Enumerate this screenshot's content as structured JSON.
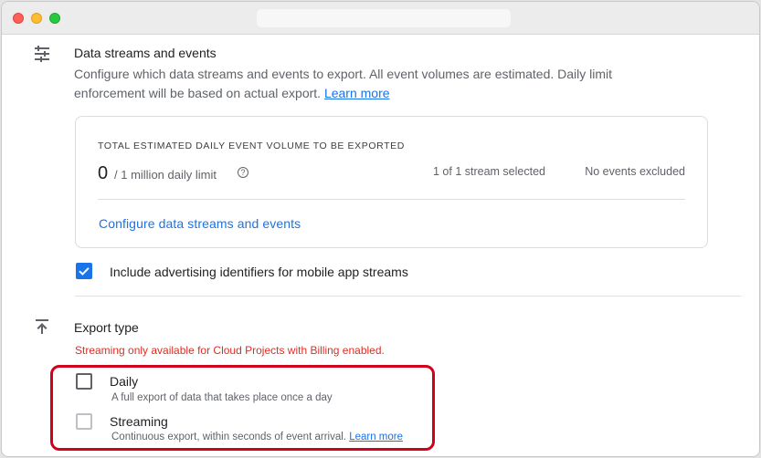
{
  "colors": {
    "accent": "#1a73e8",
    "warning": "#d93025",
    "highlight_border": "#d0021b",
    "text_primary": "#202124",
    "text_secondary": "#5f6368"
  },
  "data_streams": {
    "icon": "tune-icon",
    "title": "Data streams and events",
    "description": "Configure which data streams and events to export. All event volumes are estimated. Daily limit enforcement will be based on actual export.",
    "learn_more": "Learn more",
    "card": {
      "label": "TOTAL ESTIMATED DAILY EVENT VOLUME TO BE EXPORTED",
      "volume": "0",
      "limit": "/ 1 million daily limit",
      "help_icon": "help-icon",
      "help_glyph": "?",
      "streams_selected": "1 of 1 stream selected",
      "events_excluded": "No events excluded",
      "configure_link": "Configure data streams and events"
    },
    "advertising_ids": {
      "label": "Include advertising identifiers for mobile app streams",
      "checked": true
    }
  },
  "export_type": {
    "icon": "upload-icon",
    "title": "Export type",
    "warning": "Streaming only available for Cloud Projects with Billing enabled.",
    "options": [
      {
        "title": "Daily",
        "description": "A full export of data that takes place once a day",
        "checked": false,
        "disabled": false
      },
      {
        "title": "Streaming",
        "description": "Continuous export, within seconds of event arrival.",
        "learn_more": "Learn more",
        "checked": false,
        "disabled": true
      }
    ]
  }
}
